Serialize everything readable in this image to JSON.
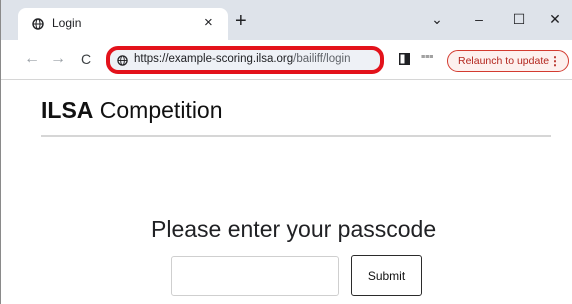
{
  "browser": {
    "tab": {
      "title": "Login",
      "favicon": "globe-icon",
      "close": "×"
    },
    "new_tab": "+",
    "window_controls": {
      "dropdown": "⌄",
      "minimize": "–",
      "maximize": "☐",
      "close": "✕"
    },
    "nav": {
      "back": "←",
      "forward": "→",
      "reload": "C"
    },
    "omnibox": {
      "host": "https://example-scoring.ilsa.org",
      "path": "/bailiff/login",
      "highlight_color": "#e3121b"
    },
    "relaunch": {
      "label": "Relaunch to update",
      "menu": "⋮"
    }
  },
  "page": {
    "brand_bold": "ILSA",
    "brand_rest": " Competition",
    "prompt": "Please enter your passcode",
    "passcode_value": "",
    "submit_label": "Submit"
  }
}
